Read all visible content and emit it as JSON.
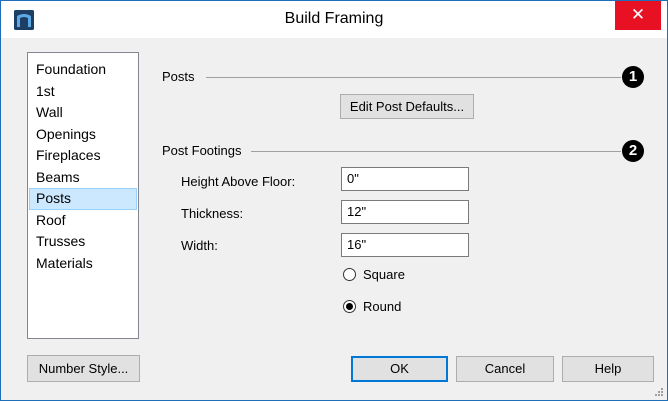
{
  "window": {
    "title": "Build Framing",
    "close_glyph": "✕"
  },
  "sidebar": {
    "items": [
      {
        "label": "Foundation",
        "selected": false
      },
      {
        "label": "1st",
        "selected": false
      },
      {
        "label": "Wall",
        "selected": false
      },
      {
        "label": "Openings",
        "selected": false
      },
      {
        "label": "Fireplaces",
        "selected": false
      },
      {
        "label": "Beams",
        "selected": false
      },
      {
        "label": "Posts",
        "selected": true
      },
      {
        "label": "Roof",
        "selected": false
      },
      {
        "label": "Trusses",
        "selected": false
      },
      {
        "label": "Materials",
        "selected": false
      }
    ]
  },
  "posts": {
    "heading": "Posts",
    "callout": "1",
    "edit_button": "Edit Post Defaults..."
  },
  "footings": {
    "heading": "Post Footings",
    "callout": "2",
    "height_label": "Height Above Floor:",
    "height_value": "0\"",
    "thickness_label": "Thickness:",
    "thickness_value": "12\"",
    "width_label": "Width:",
    "width_value": "16\"",
    "shape_options": [
      {
        "label": "Square",
        "checked": false
      },
      {
        "label": "Round",
        "checked": true
      }
    ]
  },
  "footer": {
    "number_style": "Number Style...",
    "ok": "OK",
    "cancel": "Cancel",
    "help": "Help"
  },
  "colors": {
    "selection": "#cce8ff",
    "close": "#e81123",
    "accent": "#0078d7"
  }
}
